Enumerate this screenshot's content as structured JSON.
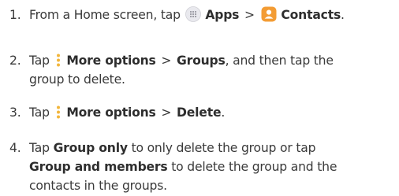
{
  "steps": [
    {
      "number": "1.",
      "t1": "From a Home screen, tap",
      "apps_label": "Apps",
      "sep": ">",
      "contacts_label": "Contacts",
      "end": "."
    },
    {
      "number": "2.",
      "t1": "Tap",
      "more_options_label": "More options",
      "sep": ">",
      "groups_label": "Groups",
      "t2": ", and then tap the",
      "line2": "group to delete."
    },
    {
      "number": "3.",
      "t1": "Tap",
      "more_options_label": "More options",
      "sep": ">",
      "delete_label": "Delete",
      "end": "."
    },
    {
      "number": "4.",
      "t1": "Tap",
      "group_only_label": "Group only",
      "t2": "to only delete the group or tap",
      "group_members_label": "Group and members",
      "t3": "to delete the group and the",
      "line3": "contacts in the groups."
    }
  ],
  "icons": {
    "apps": "apps-grid-icon",
    "contacts": "contacts-icon",
    "more_options": "more-options-vertical-dots-icon"
  },
  "colors": {
    "contacts_icon_bg": "#f39c34",
    "apps_icon_bg": "#e9e9ee",
    "more_dots": "#f2b63c"
  }
}
